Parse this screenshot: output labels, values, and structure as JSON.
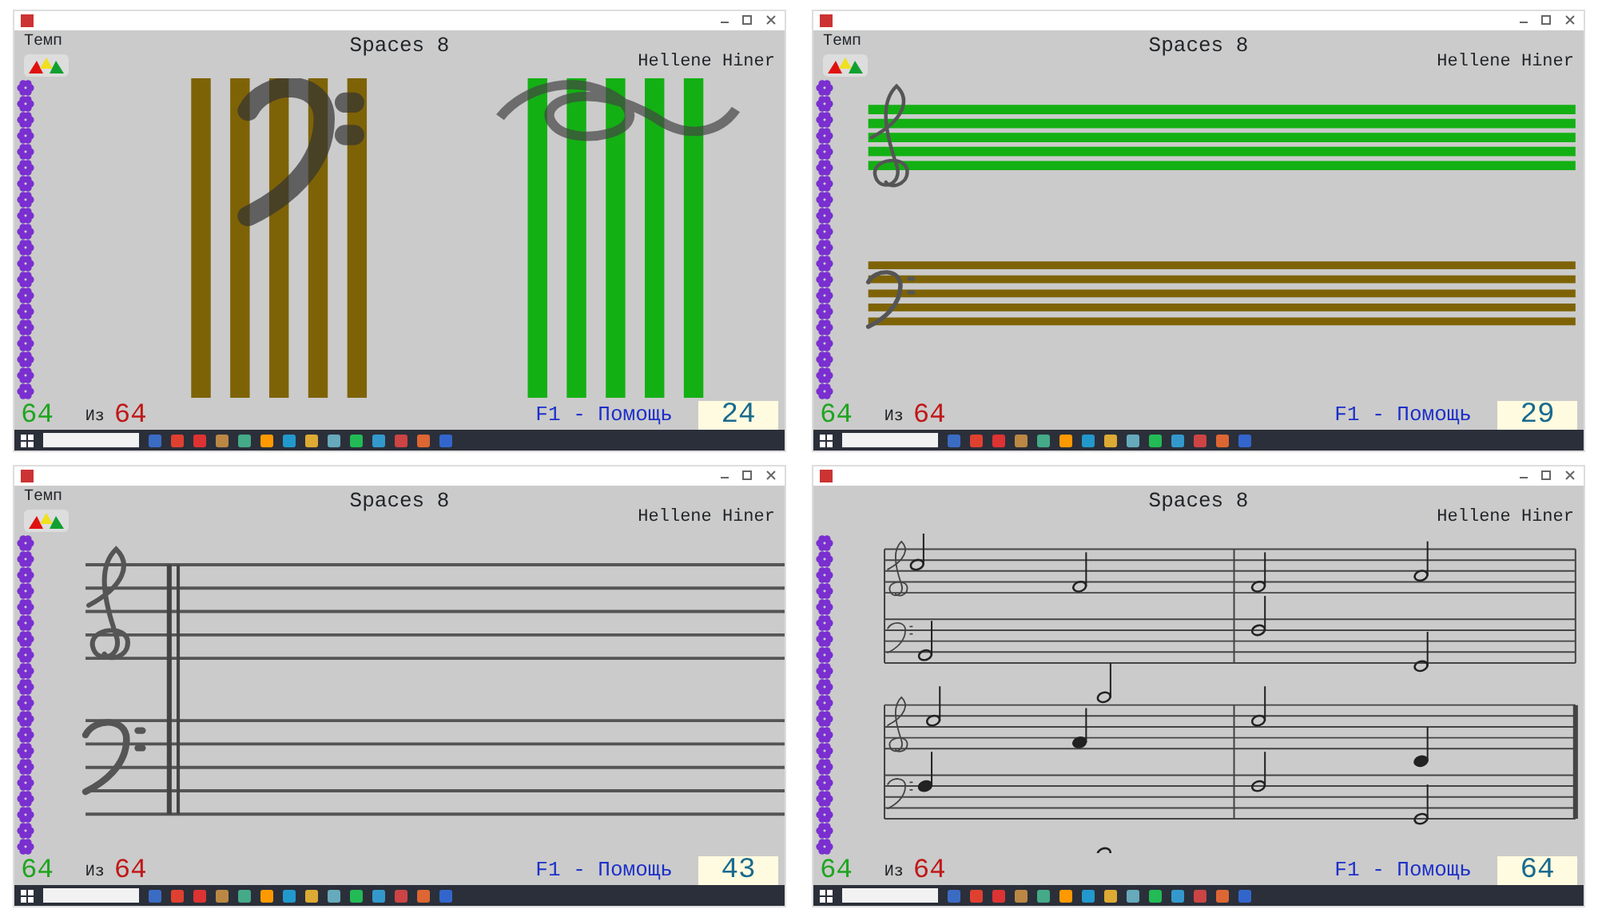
{
  "panels": [
    {
      "kind": "vertical-staffs",
      "title": "Spaces 8",
      "author": "Hellene Hiner",
      "tempo_label": "Темп",
      "current": "64",
      "of_label": "Из",
      "total": "64",
      "help": "F1 - Помощь",
      "counter": "24"
    },
    {
      "kind": "horizontal-staffs",
      "title": "Spaces 8",
      "author": "Hellene Hiner",
      "tempo_label": "Темп",
      "current": "64",
      "of_label": "Из",
      "total": "64",
      "help": "F1 - Помощь",
      "counter": "29"
    },
    {
      "kind": "grand-staff",
      "title": "Spaces 8",
      "author": "Hellene Hiner",
      "tempo_label": "Темп",
      "current": "64",
      "of_label": "Из",
      "total": "64",
      "help": "F1 - Помощь",
      "counter": "43"
    },
    {
      "kind": "score",
      "title": "Spaces 8",
      "author": "Hellene Hiner",
      "current": "64",
      "of_label": "Из",
      "total": "64",
      "help": "F1 - Помощь",
      "counter": "64"
    }
  ]
}
